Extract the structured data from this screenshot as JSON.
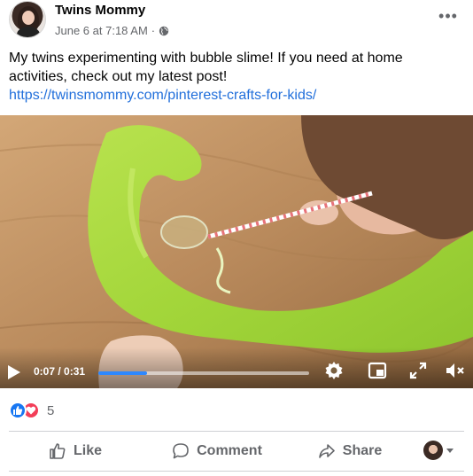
{
  "post": {
    "author": "Twins Mommy",
    "timestamp": "June 6 at 7:18 AM",
    "separator": "·",
    "privacy_icon": "globe-icon",
    "more_label": "•••",
    "text_line": "My twins experimenting with bubble slime! If you need at home activities, check out my latest post!",
    "link": "https://twinsmommy.com/pinterest-crafts-for-kids/"
  },
  "video": {
    "time": "0:07 / 0:31",
    "progress_fraction": 0.23,
    "controls": [
      "play-icon",
      "settings-icon",
      "picture-in-picture-icon",
      "fullscreen-icon",
      "mute-icon"
    ]
  },
  "reactions": {
    "types": [
      "like",
      "love"
    ],
    "count": "5"
  },
  "actions": {
    "like": "Like",
    "comment": "Comment",
    "share": "Share"
  },
  "colors": {
    "link": "#216fdb",
    "like_blue": "#1877f2",
    "love_red": "#f33e58",
    "progress": "#2d88ff",
    "secondary_text": "#65676b",
    "slime": "#a5d83d"
  }
}
